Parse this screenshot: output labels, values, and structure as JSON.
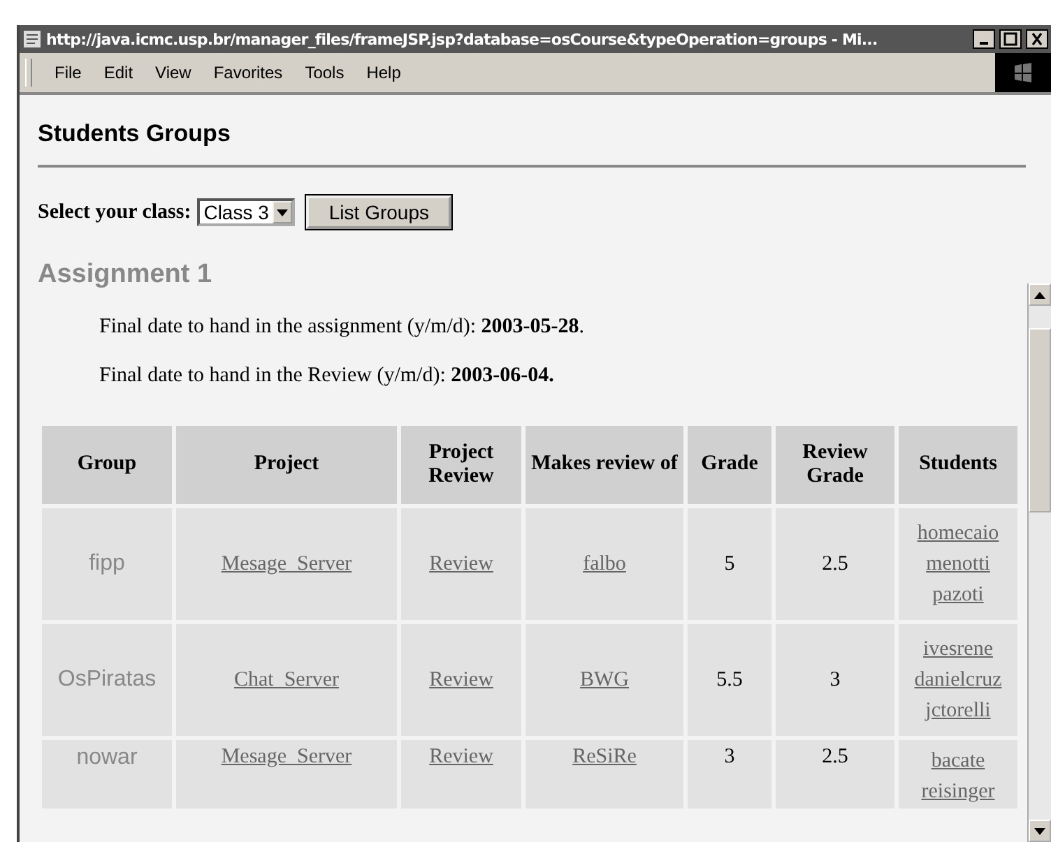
{
  "window": {
    "title": "http://java.icmc.usp.br/manager_files/frameJSP.jsp?database=osCourse&typeOperation=groups - Mi..."
  },
  "menu": [
    "File",
    "Edit",
    "View",
    "Favorites",
    "Tools",
    "Help"
  ],
  "page_title": "Students Groups",
  "class_select": {
    "label": "Select your class:",
    "value": "Class 3"
  },
  "list_button": "List Groups",
  "assignment": {
    "title": "Assignment 1",
    "dates": [
      "Final date to hand in the assignment (y/m/d): **2003-05-28**.",
      "Final date to hand in the Review (y/m/d): **2003-06-04.**"
    ]
  },
  "table": {
    "columns": [
      "Group",
      "Project",
      "Project Review",
      "Makes review of",
      "Grade",
      "Review Grade",
      "Students"
    ],
    "rows": [
      {
        "group": "fipp",
        "project": "Mesage  Server",
        "review": "Review",
        "makes_review_of": "falbo",
        "grade": "5",
        "review_grade": "2.5",
        "students": [
          "homecaio",
          "menotti",
          "pazoti"
        ]
      },
      {
        "group": "OsPiratas",
        "project": "Chat  Server",
        "review": "Review",
        "makes_review_of": "BWG",
        "grade": "5.5",
        "review_grade": "3",
        "students": [
          "ivesrene",
          "danielcruz",
          "jctorelli"
        ]
      },
      {
        "group": "nowar",
        "project": "Mesage  Server",
        "review": "Review",
        "makes_review_of": "ReSiRe",
        "grade": "3",
        "review_grade": "2.5",
        "students": [
          "bacate",
          "reisinger"
        ]
      }
    ]
  }
}
